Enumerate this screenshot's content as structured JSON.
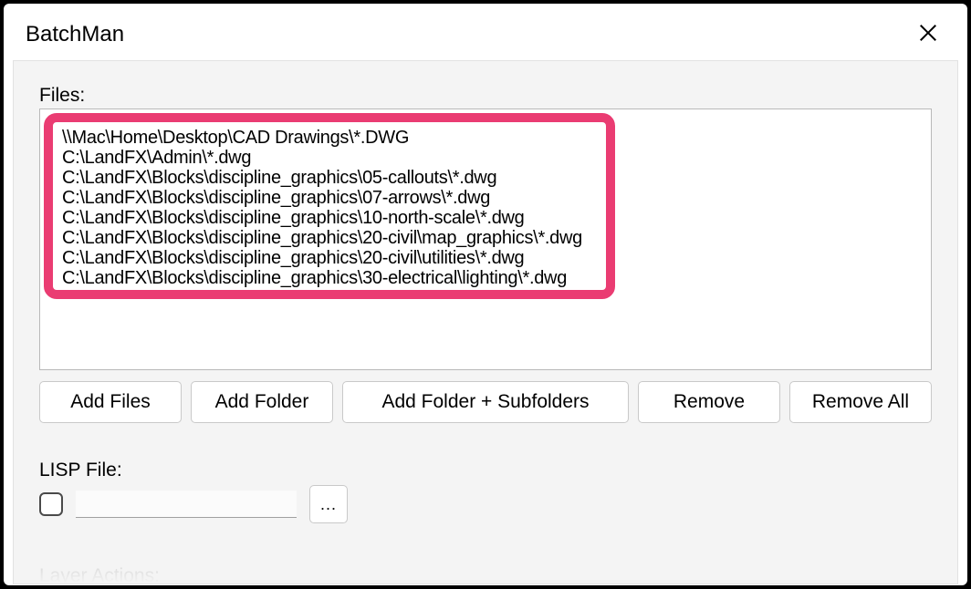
{
  "window": {
    "title": "BatchMan"
  },
  "files": {
    "label": "Files:",
    "items": [
      "\\\\Mac\\Home\\Desktop\\CAD Drawings\\*.DWG",
      "C:\\LandFX\\Admin\\*.dwg",
      "C:\\LandFX\\Blocks\\discipline_graphics\\05-callouts\\*.dwg",
      "C:\\LandFX\\Blocks\\discipline_graphics\\07-arrows\\*.dwg",
      "C:\\LandFX\\Blocks\\discipline_graphics\\10-north-scale\\*.dwg",
      "C:\\LandFX\\Blocks\\discipline_graphics\\20-civil\\map_graphics\\*.dwg",
      "C:\\LandFX\\Blocks\\discipline_graphics\\20-civil\\utilities\\*.dwg",
      "C:\\LandFX\\Blocks\\discipline_graphics\\30-electrical\\lighting\\*.dwg"
    ]
  },
  "buttons": {
    "addFiles": "Add Files",
    "addFolder": "Add Folder",
    "addFolderSub": "Add Folder + Subfolders",
    "remove": "Remove",
    "removeAll": "Remove All",
    "browse": "..."
  },
  "lisp": {
    "label": "LISP File:",
    "value": ""
  },
  "layerActions": {
    "label": "Layer Actions:"
  }
}
